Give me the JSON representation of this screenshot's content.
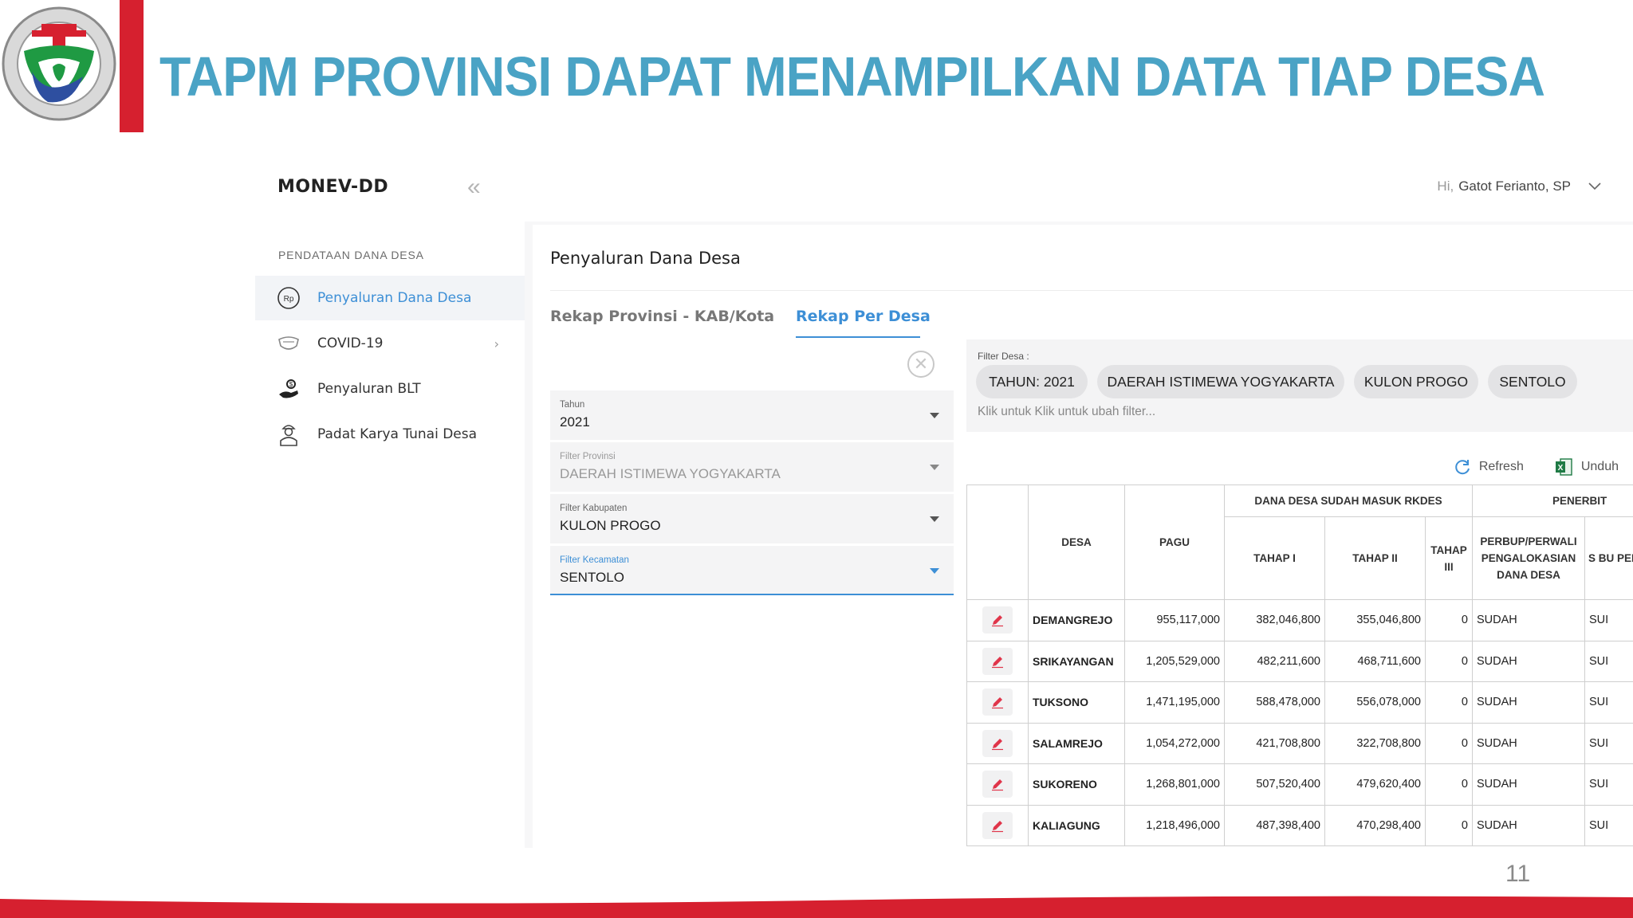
{
  "slide": {
    "title": "TAPM PROVINSI DAPAT MENAMPILKAN DATA TIAP DESA",
    "page_number": "11",
    "brand_red": "#d6202f",
    "title_color": "#4aa3c5"
  },
  "sidebar": {
    "app_title": "MONEV-DD",
    "section_label": "PENDATAAN DANA DESA",
    "items": [
      {
        "label": "Penyaluran Dana Desa",
        "icon": "rupiah-coin-icon",
        "active": true
      },
      {
        "label": "COVID-19",
        "icon": "mask-icon",
        "has_submenu": true
      },
      {
        "label": "Penyaluran BLT",
        "icon": "hand-money-icon"
      },
      {
        "label": "Padat Karya Tunai Desa",
        "icon": "worker-icon"
      }
    ]
  },
  "topbar": {
    "greeting_prefix": "Hi,",
    "user_name": "Gatot Ferianto, SP"
  },
  "page": {
    "title": "Penyaluran Dana Desa",
    "tabs": [
      "Rekap Provinsi - KAB/Kota",
      "Rekap Per Desa"
    ],
    "active_tab": "Rekap Per Desa"
  },
  "form": {
    "tahun": {
      "label": "Tahun",
      "value": "2021"
    },
    "provinsi": {
      "label": "Filter Provinsi",
      "value": "DAERAH ISTIMEWA YOGYAKARTA"
    },
    "kabupaten": {
      "label": "Filter Kabupaten",
      "value": "KULON PROGO"
    },
    "kecamatan": {
      "label": "Filter Kecamatan",
      "value": "SENTOLO"
    }
  },
  "filter_bar": {
    "label": "Filter Desa :",
    "chips": [
      "TAHUN: 2021",
      "DAERAH ISTIMEWA YOGYAKARTA",
      "KULON PROGO",
      "SENTOLO"
    ],
    "hint": "Klik untuk Klik untuk ubah filter..."
  },
  "actions": {
    "refresh": "Refresh",
    "download": "Unduh"
  },
  "table": {
    "headers": {
      "desa": "DESA",
      "pagu": "PAGU",
      "group_rkdes": "DANA DESA SUDAH MASUK RKDES",
      "group_penerbitan": "PENERBIT",
      "tahap1": "TAHAP I",
      "tahap2": "TAHAP II",
      "tahap3": "TAHAP III",
      "perbup": "PERBUP/PERWALI PENGALOKASIAN DANA DESA",
      "next": "S BU PEI"
    },
    "rows": [
      {
        "desa": "DEMANGREJO",
        "pagu": "955,117,000",
        "tahap1": "382,046,800",
        "tahap2": "355,046,800",
        "tahap3": "0",
        "perbup": "SUDAH",
        "next": "SUI"
      },
      {
        "desa": "SRIKAYANGAN",
        "pagu": "1,205,529,000",
        "tahap1": "482,211,600",
        "tahap2": "468,711,600",
        "tahap3": "0",
        "perbup": "SUDAH",
        "next": "SUI"
      },
      {
        "desa": "TUKSONO",
        "pagu": "1,471,195,000",
        "tahap1": "588,478,000",
        "tahap2": "556,078,000",
        "tahap3": "0",
        "perbup": "SUDAH",
        "next": "SUI"
      },
      {
        "desa": "SALAMREJO",
        "pagu": "1,054,272,000",
        "tahap1": "421,708,800",
        "tahap2": "322,708,800",
        "tahap3": "0",
        "perbup": "SUDAH",
        "next": "SUI"
      },
      {
        "desa": "SUKORENO",
        "pagu": "1,268,801,000",
        "tahap1": "507,520,400",
        "tahap2": "479,620,400",
        "tahap3": "0",
        "perbup": "SUDAH",
        "next": "SUI"
      },
      {
        "desa": "KALIAGUNG",
        "pagu": "1,218,496,000",
        "tahap1": "487,398,400",
        "tahap2": "470,298,400",
        "tahap3": "0",
        "perbup": "SUDAH",
        "next": "SUI"
      }
    ]
  }
}
